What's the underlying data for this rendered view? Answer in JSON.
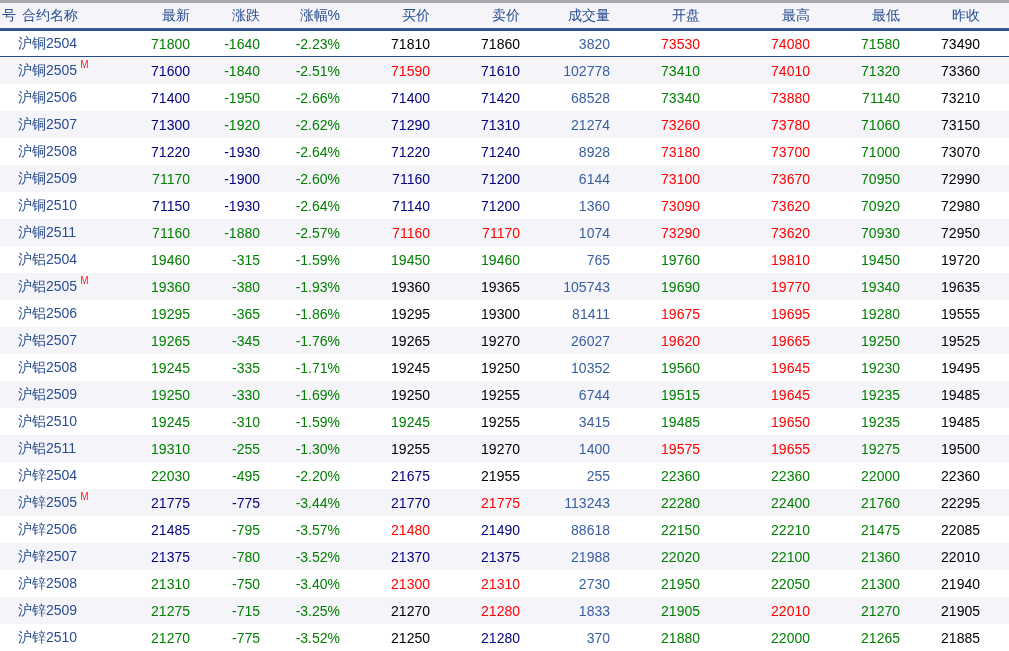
{
  "table": {
    "index_column_header": "号",
    "name_column_header": "合约名称",
    "columns": [
      "最新",
      "涨跌",
      "涨幅%",
      "买价",
      "卖价",
      "成交量",
      "开盘",
      "最高",
      "最低",
      "昨收"
    ],
    "rows": [
      {
        "name": "沪铜2504",
        "selected": true,
        "cells": [
          {
            "text": "71800",
            "color": "#008000"
          },
          {
            "text": "-1640",
            "color": "#008000"
          },
          {
            "text": "-2.23%",
            "color": "#008000"
          },
          {
            "text": "71810",
            "color": "#000000"
          },
          {
            "text": "71860",
            "color": "#000000"
          },
          {
            "text": "3820",
            "color": "#3a5fa0"
          },
          {
            "text": "73530",
            "color": "#ff0000"
          },
          {
            "text": "74080",
            "color": "#ff0000"
          },
          {
            "text": "71580",
            "color": "#008000"
          },
          {
            "text": "73490",
            "color": "#000000"
          }
        ]
      },
      {
        "name": "沪铜2505",
        "badge": "M",
        "selected": false,
        "cells": [
          {
            "text": "71600",
            "color": "#000080"
          },
          {
            "text": "-1840",
            "color": "#008000"
          },
          {
            "text": "-2.51%",
            "color": "#008000"
          },
          {
            "text": "71590",
            "color": "#ff0000"
          },
          {
            "text": "71610",
            "color": "#000080"
          },
          {
            "text": "102778",
            "color": "#3a5fa0"
          },
          {
            "text": "73410",
            "color": "#008000"
          },
          {
            "text": "74010",
            "color": "#ff0000"
          },
          {
            "text": "71320",
            "color": "#008000"
          },
          {
            "text": "73360",
            "color": "#000000"
          }
        ]
      },
      {
        "name": "沪铜2506",
        "selected": false,
        "cells": [
          {
            "text": "71400",
            "color": "#000080"
          },
          {
            "text": "-1950",
            "color": "#008000"
          },
          {
            "text": "-2.66%",
            "color": "#008000"
          },
          {
            "text": "71400",
            "color": "#000080"
          },
          {
            "text": "71420",
            "color": "#000080"
          },
          {
            "text": "68528",
            "color": "#3a5fa0"
          },
          {
            "text": "73340",
            "color": "#008000"
          },
          {
            "text": "73880",
            "color": "#ff0000"
          },
          {
            "text": "71140",
            "color": "#008000"
          },
          {
            "text": "73210",
            "color": "#000000"
          }
        ]
      },
      {
        "name": "沪铜2507",
        "selected": false,
        "cells": [
          {
            "text": "71300",
            "color": "#000080"
          },
          {
            "text": "-1920",
            "color": "#008000"
          },
          {
            "text": "-2.62%",
            "color": "#008000"
          },
          {
            "text": "71290",
            "color": "#000080"
          },
          {
            "text": "71310",
            "color": "#000080"
          },
          {
            "text": "21274",
            "color": "#3a5fa0"
          },
          {
            "text": "73260",
            "color": "#ff0000"
          },
          {
            "text": "73780",
            "color": "#ff0000"
          },
          {
            "text": "71060",
            "color": "#008000"
          },
          {
            "text": "73150",
            "color": "#000000"
          }
        ]
      },
      {
        "name": "沪铜2508",
        "selected": false,
        "cells": [
          {
            "text": "71220",
            "color": "#000080"
          },
          {
            "text": "-1930",
            "color": "#000080"
          },
          {
            "text": "-2.64%",
            "color": "#008000"
          },
          {
            "text": "71220",
            "color": "#000080"
          },
          {
            "text": "71240",
            "color": "#000080"
          },
          {
            "text": "8928",
            "color": "#3a5fa0"
          },
          {
            "text": "73180",
            "color": "#ff0000"
          },
          {
            "text": "73700",
            "color": "#ff0000"
          },
          {
            "text": "71000",
            "color": "#008000"
          },
          {
            "text": "73070",
            "color": "#000000"
          }
        ]
      },
      {
        "name": "沪铜2509",
        "selected": false,
        "cells": [
          {
            "text": "71170",
            "color": "#008000"
          },
          {
            "text": "-1900",
            "color": "#000080"
          },
          {
            "text": "-2.60%",
            "color": "#008000"
          },
          {
            "text": "71160",
            "color": "#000080"
          },
          {
            "text": "71200",
            "color": "#000080"
          },
          {
            "text": "6144",
            "color": "#3a5fa0"
          },
          {
            "text": "73100",
            "color": "#ff0000"
          },
          {
            "text": "73670",
            "color": "#ff0000"
          },
          {
            "text": "70950",
            "color": "#008000"
          },
          {
            "text": "72990",
            "color": "#000000"
          }
        ]
      },
      {
        "name": "沪铜2510",
        "selected": false,
        "cells": [
          {
            "text": "71150",
            "color": "#000080"
          },
          {
            "text": "-1930",
            "color": "#000080"
          },
          {
            "text": "-2.64%",
            "color": "#008000"
          },
          {
            "text": "71140",
            "color": "#000080"
          },
          {
            "text": "71200",
            "color": "#000080"
          },
          {
            "text": "1360",
            "color": "#3a5fa0"
          },
          {
            "text": "73090",
            "color": "#ff0000"
          },
          {
            "text": "73620",
            "color": "#ff0000"
          },
          {
            "text": "70920",
            "color": "#008000"
          },
          {
            "text": "72980",
            "color": "#000000"
          }
        ]
      },
      {
        "name": "沪铜2511",
        "selected": false,
        "cells": [
          {
            "text": "71160",
            "color": "#008000"
          },
          {
            "text": "-1880",
            "color": "#008000"
          },
          {
            "text": "-2.57%",
            "color": "#008000"
          },
          {
            "text": "71160",
            "color": "#ff0000"
          },
          {
            "text": "71170",
            "color": "#ff0000"
          },
          {
            "text": "1074",
            "color": "#3a5fa0"
          },
          {
            "text": "73290",
            "color": "#ff0000"
          },
          {
            "text": "73620",
            "color": "#ff0000"
          },
          {
            "text": "70930",
            "color": "#008000"
          },
          {
            "text": "72950",
            "color": "#000000"
          }
        ]
      },
      {
        "name": "沪铝2504",
        "selected": false,
        "cells": [
          {
            "text": "19460",
            "color": "#008000"
          },
          {
            "text": "-315",
            "color": "#008000"
          },
          {
            "text": "-1.59%",
            "color": "#008000"
          },
          {
            "text": "19450",
            "color": "#008000"
          },
          {
            "text": "19460",
            "color": "#008000"
          },
          {
            "text": "765",
            "color": "#3a5fa0"
          },
          {
            "text": "19760",
            "color": "#008000"
          },
          {
            "text": "19810",
            "color": "#ff0000"
          },
          {
            "text": "19450",
            "color": "#008000"
          },
          {
            "text": "19720",
            "color": "#000000"
          }
        ]
      },
      {
        "name": "沪铝2505",
        "badge": "M",
        "selected": false,
        "cells": [
          {
            "text": "19360",
            "color": "#008000"
          },
          {
            "text": "-380",
            "color": "#008000"
          },
          {
            "text": "-1.93%",
            "color": "#008000"
          },
          {
            "text": "19360",
            "color": "#000000"
          },
          {
            "text": "19365",
            "color": "#000000"
          },
          {
            "text": "105743",
            "color": "#3a5fa0"
          },
          {
            "text": "19690",
            "color": "#008000"
          },
          {
            "text": "19770",
            "color": "#ff0000"
          },
          {
            "text": "19340",
            "color": "#008000"
          },
          {
            "text": "19635",
            "color": "#000000"
          }
        ]
      },
      {
        "name": "沪铝2506",
        "selected": false,
        "cells": [
          {
            "text": "19295",
            "color": "#008000"
          },
          {
            "text": "-365",
            "color": "#008000"
          },
          {
            "text": "-1.86%",
            "color": "#008000"
          },
          {
            "text": "19295",
            "color": "#000000"
          },
          {
            "text": "19300",
            "color": "#000000"
          },
          {
            "text": "81411",
            "color": "#3a5fa0"
          },
          {
            "text": "19675",
            "color": "#ff0000"
          },
          {
            "text": "19695",
            "color": "#ff0000"
          },
          {
            "text": "19280",
            "color": "#008000"
          },
          {
            "text": "19555",
            "color": "#000000"
          }
        ]
      },
      {
        "name": "沪铝2507",
        "selected": false,
        "cells": [
          {
            "text": "19265",
            "color": "#008000"
          },
          {
            "text": "-345",
            "color": "#008000"
          },
          {
            "text": "-1.76%",
            "color": "#008000"
          },
          {
            "text": "19265",
            "color": "#000000"
          },
          {
            "text": "19270",
            "color": "#000000"
          },
          {
            "text": "26027",
            "color": "#3a5fa0"
          },
          {
            "text": "19620",
            "color": "#ff0000"
          },
          {
            "text": "19665",
            "color": "#ff0000"
          },
          {
            "text": "19250",
            "color": "#008000"
          },
          {
            "text": "19525",
            "color": "#000000"
          }
        ]
      },
      {
        "name": "沪铝2508",
        "selected": false,
        "cells": [
          {
            "text": "19245",
            "color": "#008000"
          },
          {
            "text": "-335",
            "color": "#008000"
          },
          {
            "text": "-1.71%",
            "color": "#008000"
          },
          {
            "text": "19245",
            "color": "#000000"
          },
          {
            "text": "19250",
            "color": "#000000"
          },
          {
            "text": "10352",
            "color": "#3a5fa0"
          },
          {
            "text": "19560",
            "color": "#008000"
          },
          {
            "text": "19645",
            "color": "#ff0000"
          },
          {
            "text": "19230",
            "color": "#008000"
          },
          {
            "text": "19495",
            "color": "#000000"
          }
        ]
      },
      {
        "name": "沪铝2509",
        "selected": false,
        "cells": [
          {
            "text": "19250",
            "color": "#008000"
          },
          {
            "text": "-330",
            "color": "#008000"
          },
          {
            "text": "-1.69%",
            "color": "#008000"
          },
          {
            "text": "19250",
            "color": "#000000"
          },
          {
            "text": "19255",
            "color": "#000000"
          },
          {
            "text": "6744",
            "color": "#3a5fa0"
          },
          {
            "text": "19515",
            "color": "#008000"
          },
          {
            "text": "19645",
            "color": "#ff0000"
          },
          {
            "text": "19235",
            "color": "#008000"
          },
          {
            "text": "19485",
            "color": "#000000"
          }
        ]
      },
      {
        "name": "沪铝2510",
        "selected": false,
        "cells": [
          {
            "text": "19245",
            "color": "#008000"
          },
          {
            "text": "-310",
            "color": "#008000"
          },
          {
            "text": "-1.59%",
            "color": "#008000"
          },
          {
            "text": "19245",
            "color": "#008000"
          },
          {
            "text": "19255",
            "color": "#000000"
          },
          {
            "text": "3415",
            "color": "#3a5fa0"
          },
          {
            "text": "19485",
            "color": "#008000"
          },
          {
            "text": "19650",
            "color": "#ff0000"
          },
          {
            "text": "19235",
            "color": "#008000"
          },
          {
            "text": "19485",
            "color": "#000000"
          }
        ]
      },
      {
        "name": "沪铝2511",
        "selected": false,
        "cells": [
          {
            "text": "19310",
            "color": "#008000"
          },
          {
            "text": "-255",
            "color": "#008000"
          },
          {
            "text": "-1.30%",
            "color": "#008000"
          },
          {
            "text": "19255",
            "color": "#000000"
          },
          {
            "text": "19270",
            "color": "#000000"
          },
          {
            "text": "1400",
            "color": "#3a5fa0"
          },
          {
            "text": "19575",
            "color": "#ff0000"
          },
          {
            "text": "19655",
            "color": "#ff0000"
          },
          {
            "text": "19275",
            "color": "#008000"
          },
          {
            "text": "19500",
            "color": "#000000"
          }
        ]
      },
      {
        "name": "沪锌2504",
        "selected": false,
        "cells": [
          {
            "text": "22030",
            "color": "#008000"
          },
          {
            "text": "-495",
            "color": "#008000"
          },
          {
            "text": "-2.20%",
            "color": "#008000"
          },
          {
            "text": "21675",
            "color": "#000080"
          },
          {
            "text": "21955",
            "color": "#000000"
          },
          {
            "text": "255",
            "color": "#3a5fa0"
          },
          {
            "text": "22360",
            "color": "#008000"
          },
          {
            "text": "22360",
            "color": "#008000"
          },
          {
            "text": "22000",
            "color": "#008000"
          },
          {
            "text": "22360",
            "color": "#000000"
          }
        ]
      },
      {
        "name": "沪锌2505",
        "badge": "M",
        "selected": false,
        "cells": [
          {
            "text": "21775",
            "color": "#000080"
          },
          {
            "text": "-775",
            "color": "#000080"
          },
          {
            "text": "-3.44%",
            "color": "#008000"
          },
          {
            "text": "21770",
            "color": "#000080"
          },
          {
            "text": "21775",
            "color": "#ff0000"
          },
          {
            "text": "113243",
            "color": "#3a5fa0"
          },
          {
            "text": "22280",
            "color": "#008000"
          },
          {
            "text": "22400",
            "color": "#008000"
          },
          {
            "text": "21760",
            "color": "#008000"
          },
          {
            "text": "22295",
            "color": "#000000"
          }
        ]
      },
      {
        "name": "沪锌2506",
        "selected": false,
        "cells": [
          {
            "text": "21485",
            "color": "#000080"
          },
          {
            "text": "-795",
            "color": "#008000"
          },
          {
            "text": "-3.57%",
            "color": "#008000"
          },
          {
            "text": "21480",
            "color": "#ff0000"
          },
          {
            "text": "21490",
            "color": "#000080"
          },
          {
            "text": "88618",
            "color": "#3a5fa0"
          },
          {
            "text": "22150",
            "color": "#008000"
          },
          {
            "text": "22210",
            "color": "#008000"
          },
          {
            "text": "21475",
            "color": "#008000"
          },
          {
            "text": "22085",
            "color": "#000000"
          }
        ]
      },
      {
        "name": "沪锌2507",
        "selected": false,
        "cells": [
          {
            "text": "21375",
            "color": "#000080"
          },
          {
            "text": "-780",
            "color": "#008000"
          },
          {
            "text": "-3.52%",
            "color": "#008000"
          },
          {
            "text": "21370",
            "color": "#000080"
          },
          {
            "text": "21375",
            "color": "#000080"
          },
          {
            "text": "21988",
            "color": "#3a5fa0"
          },
          {
            "text": "22020",
            "color": "#008000"
          },
          {
            "text": "22100",
            "color": "#008000"
          },
          {
            "text": "21360",
            "color": "#008000"
          },
          {
            "text": "22010",
            "color": "#000000"
          }
        ]
      },
      {
        "name": "沪锌2508",
        "selected": false,
        "cells": [
          {
            "text": "21310",
            "color": "#008000"
          },
          {
            "text": "-750",
            "color": "#008000"
          },
          {
            "text": "-3.40%",
            "color": "#008000"
          },
          {
            "text": "21300",
            "color": "#ff0000"
          },
          {
            "text": "21310",
            "color": "#ff0000"
          },
          {
            "text": "2730",
            "color": "#3a5fa0"
          },
          {
            "text": "21950",
            "color": "#008000"
          },
          {
            "text": "22050",
            "color": "#008000"
          },
          {
            "text": "21300",
            "color": "#008000"
          },
          {
            "text": "21940",
            "color": "#000000"
          }
        ]
      },
      {
        "name": "沪锌2509",
        "selected": false,
        "cells": [
          {
            "text": "21275",
            "color": "#008000"
          },
          {
            "text": "-715",
            "color": "#008000"
          },
          {
            "text": "-3.25%",
            "color": "#008000"
          },
          {
            "text": "21270",
            "color": "#000000"
          },
          {
            "text": "21280",
            "color": "#ff0000"
          },
          {
            "text": "1833",
            "color": "#3a5fa0"
          },
          {
            "text": "21905",
            "color": "#008000"
          },
          {
            "text": "22010",
            "color": "#ff0000"
          },
          {
            "text": "21270",
            "color": "#008000"
          },
          {
            "text": "21905",
            "color": "#000000"
          }
        ]
      },
      {
        "name": "沪锌2510",
        "selected": false,
        "cells": [
          {
            "text": "21270",
            "color": "#008000"
          },
          {
            "text": "-775",
            "color": "#008000"
          },
          {
            "text": "-3.52%",
            "color": "#008000"
          },
          {
            "text": "21250",
            "color": "#000000"
          },
          {
            "text": "21280",
            "color": "#000080"
          },
          {
            "text": "370",
            "color": "#3a5fa0"
          },
          {
            "text": "21880",
            "color": "#008000"
          },
          {
            "text": "22000",
            "color": "#008000"
          },
          {
            "text": "21265",
            "color": "#008000"
          },
          {
            "text": "21885",
            "color": "#000000"
          }
        ]
      }
    ]
  }
}
